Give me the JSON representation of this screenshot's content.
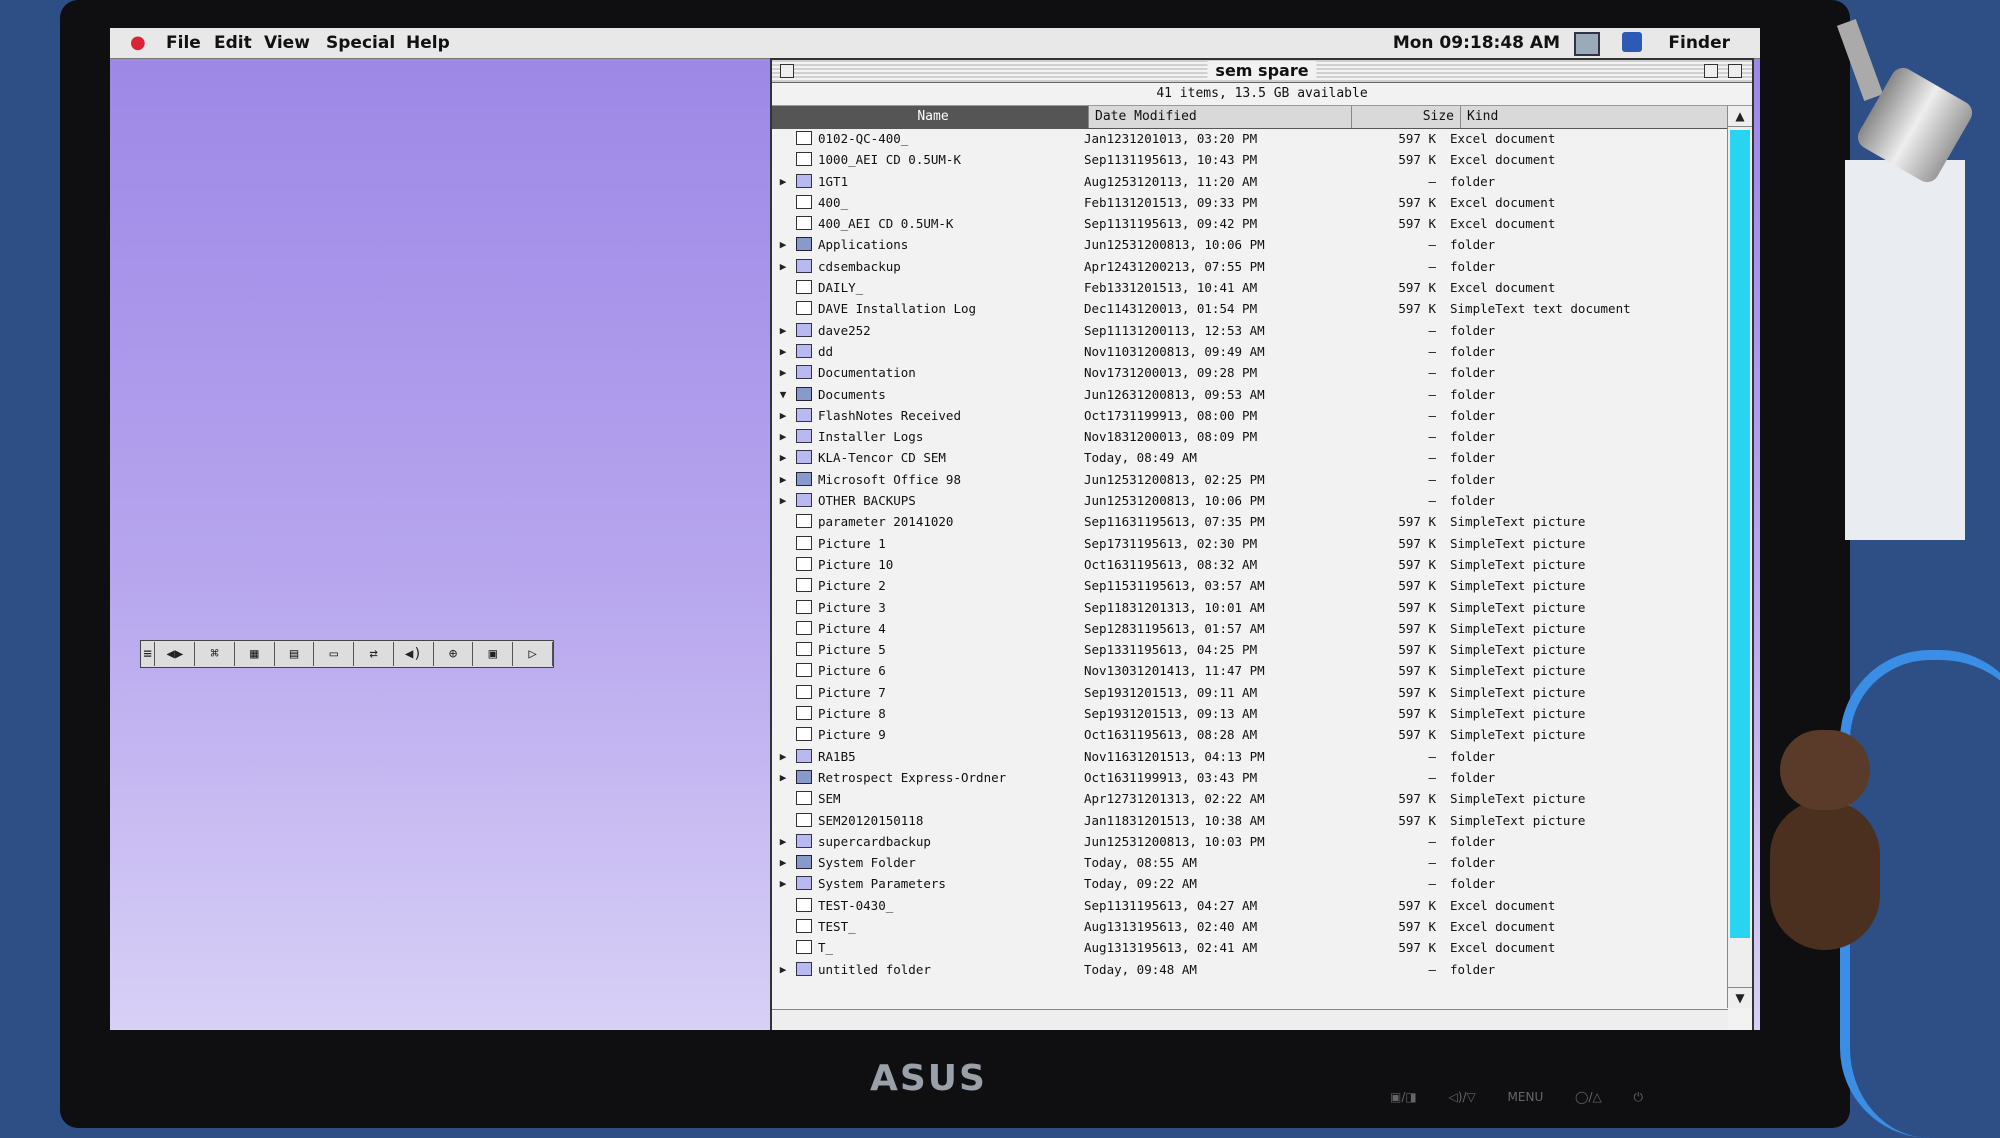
{
  "menubar": {
    "items": [
      "File",
      "Edit",
      "View",
      "Special",
      "Help"
    ],
    "clock": "Mon 09:18:48 AM",
    "app": "Finder"
  },
  "control_strip": {
    "segments": [
      "≡",
      "◀▶",
      "⌘",
      "▦",
      "▤",
      "▭",
      "⇄",
      "◀)",
      "⊕",
      "▣",
      "▷"
    ]
  },
  "window": {
    "title": "sem spare",
    "info": "41 items, 13.5 GB available",
    "columns": {
      "name": "Name",
      "date": "Date Modified",
      "size": "Size",
      "kind": "Kind"
    },
    "rows": [
      {
        "name": "0102-QC-400_",
        "date": "Jan1231201013, 03:20 PM",
        "size": "597 K",
        "kind": "Excel document",
        "type": "doc",
        "disc": ""
      },
      {
        "name": "1000_AEI CD 0.5UM-K",
        "date": "Sep1131195613, 10:43 PM",
        "size": "597 K",
        "kind": "Excel document",
        "type": "doc",
        "disc": ""
      },
      {
        "name": "1GT1",
        "date": "Aug1253120113, 11:20 AM",
        "size": "—",
        "kind": "folder",
        "type": "folder",
        "disc": "▶"
      },
      {
        "name": "400_",
        "date": "Feb1131201513, 09:33 PM",
        "size": "597 K",
        "kind": "Excel document",
        "type": "doc",
        "disc": ""
      },
      {
        "name": "400_AEI CD 0.5UM-K",
        "date": "Sep1131195613, 09:42 PM",
        "size": "597 K",
        "kind": "Excel document",
        "type": "doc",
        "disc": ""
      },
      {
        "name": "Applications",
        "date": "Jun12531200813, 10:06 PM",
        "size": "—",
        "kind": "folder",
        "type": "app",
        "disc": "▶"
      },
      {
        "name": "cdsembackup",
        "date": "Apr12431200213, 07:55 PM",
        "size": "—",
        "kind": "folder",
        "type": "folder",
        "disc": "▶"
      },
      {
        "name": "DAILY_",
        "date": "Feb1331201513, 10:41 AM",
        "size": "597 K",
        "kind": "Excel document",
        "type": "doc",
        "disc": ""
      },
      {
        "name": "DAVE Installation Log",
        "date": "Dec1143120013, 01:54 PM",
        "size": "597 K",
        "kind": "SimpleText text document",
        "type": "doc",
        "disc": ""
      },
      {
        "name": "dave252",
        "date": "Sep11131200113, 12:53 AM",
        "size": "—",
        "kind": "folder",
        "type": "folder",
        "disc": "▶"
      },
      {
        "name": "dd",
        "date": "Nov11031200813, 09:49 AM",
        "size": "—",
        "kind": "folder",
        "type": "folder",
        "disc": "▶"
      },
      {
        "name": "Documentation",
        "date": "Nov1731200013, 09:28 PM",
        "size": "—",
        "kind": "folder",
        "type": "folder",
        "disc": "▶"
      },
      {
        "name": "Documents",
        "date": "Jun12631200813, 09:53 AM",
        "size": "—",
        "kind": "folder",
        "type": "app",
        "disc": "▼"
      },
      {
        "name": "FlashNotes Received",
        "date": "Oct1731199913, 08:00 PM",
        "size": "—",
        "kind": "folder",
        "type": "folder",
        "disc": "▶"
      },
      {
        "name": "Installer Logs",
        "date": "Nov1831200013, 08:09 PM",
        "size": "—",
        "kind": "folder",
        "type": "folder",
        "disc": "▶"
      },
      {
        "name": "KLA-Tencor CD SEM",
        "date": "Today, 08:49 AM",
        "size": "—",
        "kind": "folder",
        "type": "folder",
        "disc": "▶"
      },
      {
        "name": "Microsoft Office 98",
        "date": "Jun12531200813, 02:25 PM",
        "size": "—",
        "kind": "folder",
        "type": "app",
        "disc": "▶"
      },
      {
        "name": "OTHER BACKUPS",
        "date": "Jun12531200813, 10:06 PM",
        "size": "—",
        "kind": "folder",
        "type": "folder",
        "disc": "▶"
      },
      {
        "name": "parameter 20141020",
        "date": "Sep11631195613, 07:35 PM",
        "size": "597 K",
        "kind": "SimpleText picture",
        "type": "doc",
        "disc": ""
      },
      {
        "name": "Picture 1",
        "date": "Sep1731195613, 02:30 PM",
        "size": "597 K",
        "kind": "SimpleText picture",
        "type": "doc",
        "disc": ""
      },
      {
        "name": "Picture 10",
        "date": "Oct1631195613, 08:32 AM",
        "size": "597 K",
        "kind": "SimpleText picture",
        "type": "doc",
        "disc": ""
      },
      {
        "name": "Picture 2",
        "date": "Sep11531195613, 03:57 AM",
        "size": "597 K",
        "kind": "SimpleText picture",
        "type": "doc",
        "disc": ""
      },
      {
        "name": "Picture 3",
        "date": "Sep11831201313, 10:01 AM",
        "size": "597 K",
        "kind": "SimpleText picture",
        "type": "doc",
        "disc": ""
      },
      {
        "name": "Picture 4",
        "date": "Sep12831195613, 01:57 AM",
        "size": "597 K",
        "kind": "SimpleText picture",
        "type": "doc",
        "disc": ""
      },
      {
        "name": "Picture 5",
        "date": "Sep1331195613, 04:25 PM",
        "size": "597 K",
        "kind": "SimpleText picture",
        "type": "doc",
        "disc": ""
      },
      {
        "name": "Picture 6",
        "date": "Nov13031201413, 11:47 PM",
        "size": "597 K",
        "kind": "SimpleText picture",
        "type": "doc",
        "disc": ""
      },
      {
        "name": "Picture 7",
        "date": "Sep1931201513, 09:11 AM",
        "size": "597 K",
        "kind": "SimpleText picture",
        "type": "doc",
        "disc": ""
      },
      {
        "name": "Picture 8",
        "date": "Sep1931201513, 09:13 AM",
        "size": "597 K",
        "kind": "SimpleText picture",
        "type": "doc",
        "disc": ""
      },
      {
        "name": "Picture 9",
        "date": "Oct1631195613, 08:28 AM",
        "size": "597 K",
        "kind": "SimpleText picture",
        "type": "doc",
        "disc": ""
      },
      {
        "name": "RA1B5",
        "date": "Nov11631201513, 04:13 PM",
        "size": "—",
        "kind": "folder",
        "type": "folder",
        "disc": "▶"
      },
      {
        "name": "Retrospect Express-Ordner",
        "date": "Oct1631199913, 03:43 PM",
        "size": "—",
        "kind": "folder",
        "type": "app",
        "disc": "▶"
      },
      {
        "name": "SEM",
        "date": "Apr12731201313, 02:22 AM",
        "size": "597 K",
        "kind": "SimpleText picture",
        "type": "doc",
        "disc": ""
      },
      {
        "name": "SEM20120150118",
        "date": "Jan11831201513, 10:38 AM",
        "size": "597 K",
        "kind": "SimpleText picture",
        "type": "doc",
        "disc": ""
      },
      {
        "name": "supercardbackup",
        "date": "Jun12531200813, 10:03 PM",
        "size": "—",
        "kind": "folder",
        "type": "folder",
        "disc": "▶"
      },
      {
        "name": "System Folder",
        "date": "Today, 08:55 AM",
        "size": "—",
        "kind": "folder",
        "type": "app",
        "disc": "▶"
      },
      {
        "name": "System Parameters",
        "date": "Today, 09:22 AM",
        "size": "—",
        "kind": "folder",
        "type": "folder",
        "disc": "▶"
      },
      {
        "name": "TEST-0430_",
        "date": "Sep1131195613, 04:27 AM",
        "size": "597 K",
        "kind": "Excel document",
        "type": "doc",
        "disc": ""
      },
      {
        "name": "TEST_",
        "date": "Aug1313195613, 02:40 AM",
        "size": "597 K",
        "kind": "Excel document",
        "type": "doc",
        "disc": ""
      },
      {
        "name": "T_",
        "date": "Aug1313195613, 02:41 AM",
        "size": "597 K",
        "kind": "Excel document",
        "type": "doc",
        "disc": ""
      },
      {
        "name": "untitled folder",
        "date": "Today, 09:48 AM",
        "size": "—",
        "kind": "folder",
        "type": "folder",
        "disc": "▶"
      }
    ]
  },
  "monitor": {
    "brand": "ASUS",
    "buttons": "▣/◨ ◁)/▽ MENU ◯/△ ⏻"
  }
}
